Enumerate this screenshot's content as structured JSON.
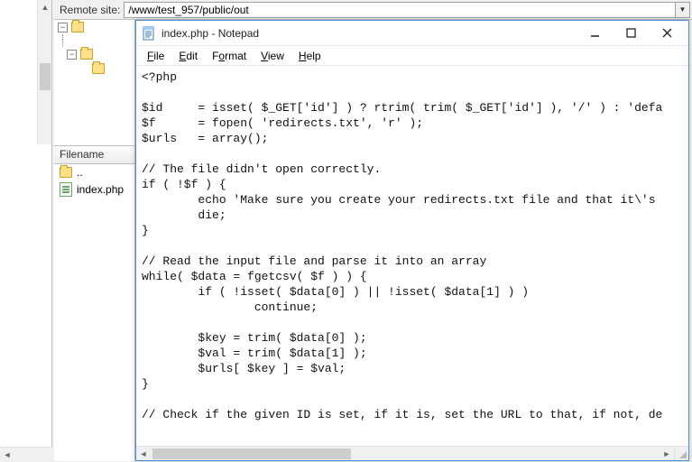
{
  "remote": {
    "label": "Remote site:",
    "path": "/www/test_957/public/out"
  },
  "filelist": {
    "header": "Filename",
    "parent": "..",
    "items": [
      {
        "name": "index.php"
      }
    ]
  },
  "notepad": {
    "title": "index.php - Notepad",
    "menus": {
      "file": "File",
      "edit": "Edit",
      "format": "Format",
      "view": "View",
      "help": "Help"
    },
    "text": "<?php\n\n$id     = isset( $_GET['id'] ) ? rtrim( trim( $_GET['id'] ), '/' ) : 'defa\n$f      = fopen( 'redirects.txt', 'r' );\n$urls   = array();\n\n// The file didn't open correctly.\nif ( !$f ) {\n        echo 'Make sure you create your redirects.txt file and that it\\'s \n        die;\n}\n\n// Read the input file and parse it into an array\nwhile( $data = fgetcsv( $f ) ) {\n        if ( !isset( $data[0] ) || !isset( $data[1] ) )\n                continue;\n\n        $key = trim( $data[0] );\n        $val = trim( $data[1] );\n        $urls[ $key ] = $val;\n}\n\n// Check if the given ID is set, if it is, set the URL to that, if not, de\n"
  }
}
